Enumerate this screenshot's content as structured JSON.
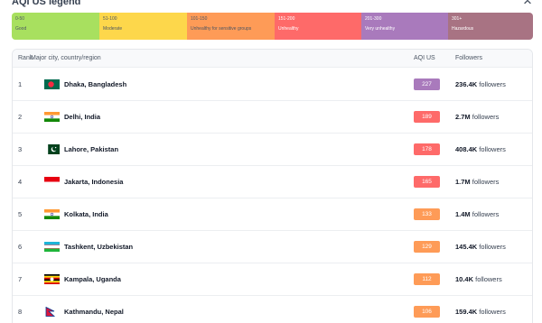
{
  "legend": {
    "title": "AQI US legend",
    "segments": [
      {
        "range": "0-50",
        "label": "Good",
        "color": "#a8e05f"
      },
      {
        "range": "51-100",
        "label": "Moderate",
        "color": "#fdd74b"
      },
      {
        "range": "101-150",
        "label": "Unhealthy for sensitive groups",
        "color": "#fe9b57"
      },
      {
        "range": "151-200",
        "label": "Unhealthy",
        "color": "#fe6a69"
      },
      {
        "range": "201-300",
        "label": "Very unhealthy",
        "color": "#a97abc"
      },
      {
        "range": "301+",
        "label": "Hazardous",
        "color": "#a87383"
      }
    ]
  },
  "table": {
    "headers": {
      "rank": "Rank",
      "city": "Major city, country/region",
      "aqi": "AQI US",
      "followers": "Followers"
    },
    "followers_suffix": "followers",
    "rows": [
      {
        "rank": "1",
        "flag": "bangladesh-flag-icon",
        "city": "Dhaka, Bangladesh",
        "aqi": "227",
        "aqi_color": "#a97abc",
        "followers": "236.4K"
      },
      {
        "rank": "2",
        "flag": "india-flag-icon",
        "city": "Delhi, India",
        "aqi": "189",
        "aqi_color": "#fe6a69",
        "followers": "2.7M"
      },
      {
        "rank": "3",
        "flag": "pakistan-flag-icon",
        "city": "Lahore, Pakistan",
        "aqi": "178",
        "aqi_color": "#fe6a69",
        "followers": "408.4K"
      },
      {
        "rank": "4",
        "flag": "indonesia-flag-icon",
        "city": "Jakarta, Indonesia",
        "aqi": "165",
        "aqi_color": "#fe6a69",
        "followers": "1.7M"
      },
      {
        "rank": "5",
        "flag": "india-flag-icon",
        "city": "Kolkata, India",
        "aqi": "133",
        "aqi_color": "#fe9b57",
        "followers": "1.4M"
      },
      {
        "rank": "6",
        "flag": "uzbekistan-flag-icon",
        "city": "Tashkent, Uzbekistan",
        "aqi": "129",
        "aqi_color": "#fe9b57",
        "followers": "145.4K"
      },
      {
        "rank": "7",
        "flag": "uganda-flag-icon",
        "city": "Kampala, Uganda",
        "aqi": "112",
        "aqi_color": "#fe9b57",
        "followers": "10.4K"
      },
      {
        "rank": "8",
        "flag": "nepal-flag-icon",
        "city": "Kathmandu, Nepal",
        "aqi": "106",
        "aqi_color": "#fe9b57",
        "followers": "159.4K"
      }
    ]
  }
}
